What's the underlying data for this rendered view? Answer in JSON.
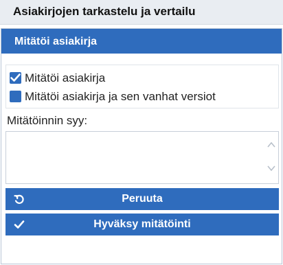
{
  "header": {
    "title": "Asiakirjojen tarkastelu ja vertailu"
  },
  "panel": {
    "title": "Mitätöi asiakirja",
    "options": [
      {
        "label": "Mitätöi asiakirja",
        "checked": true
      },
      {
        "label": "Mitätöi asiakirja ja sen vanhat versiot",
        "checked": false
      }
    ],
    "reason_label": "Mitätöinnin syy:",
    "reason_value": "",
    "cancel_label": "Peruuta",
    "accept_label": "Hyväksy mitätöinti"
  },
  "colors": {
    "accent": "#2f6cbd",
    "header_bg": "#e9edf2"
  },
  "icons": {
    "cancel": "undo-icon",
    "accept": "check-icon",
    "checkbox": "checkmark-icon"
  }
}
